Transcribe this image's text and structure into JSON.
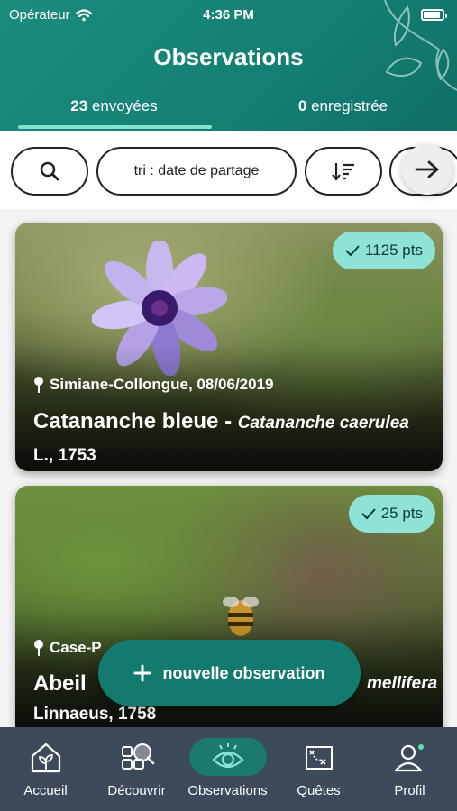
{
  "status_bar": {
    "carrier": "Opérateur",
    "time": "4:36 PM",
    "battery_level": 0.9
  },
  "header": {
    "title": "Observations",
    "tabs": [
      {
        "count": "23",
        "label": "envoyées",
        "active": true
      },
      {
        "count": "0",
        "label": "enregistrée",
        "active": false
      }
    ]
  },
  "filters": {
    "search_icon": "search-icon",
    "sort_label": "tri : date de partage",
    "order_icon": "sort-descending-icon",
    "next_icon": "arrow-right-icon"
  },
  "observations": [
    {
      "points": "1125 pts",
      "location": "Simiane-Collongue, 08/06/2019",
      "common_name": "Catananche bleue - ",
      "latin_name": "Catananche caerulea",
      "author": " L., 1753"
    },
    {
      "points": "25 pts",
      "location": "Case-P",
      "common_name": "Abeil",
      "latin_name": "mellifera",
      "author": "Linnaeus, 1758"
    }
  ],
  "fab": {
    "label": "nouvelle observation",
    "icon": "plus-icon"
  },
  "nav": [
    {
      "label": "Accueil",
      "icon": "home-plant-icon",
      "active": false
    },
    {
      "label": "Découvrir",
      "icon": "discover-grid-icon",
      "active": false
    },
    {
      "label": "Observations",
      "icon": "eye-icon",
      "active": true
    },
    {
      "label": "Quêtes",
      "icon": "treasure-map-icon",
      "active": false
    },
    {
      "label": "Profil",
      "icon": "user-profile-icon",
      "active": false
    }
  ],
  "colors": {
    "header": "#147f73",
    "accent": "#8ee3d6",
    "fab": "#127a6f",
    "nav": "#3d4a5c",
    "nav_active": "#1b7a70"
  }
}
